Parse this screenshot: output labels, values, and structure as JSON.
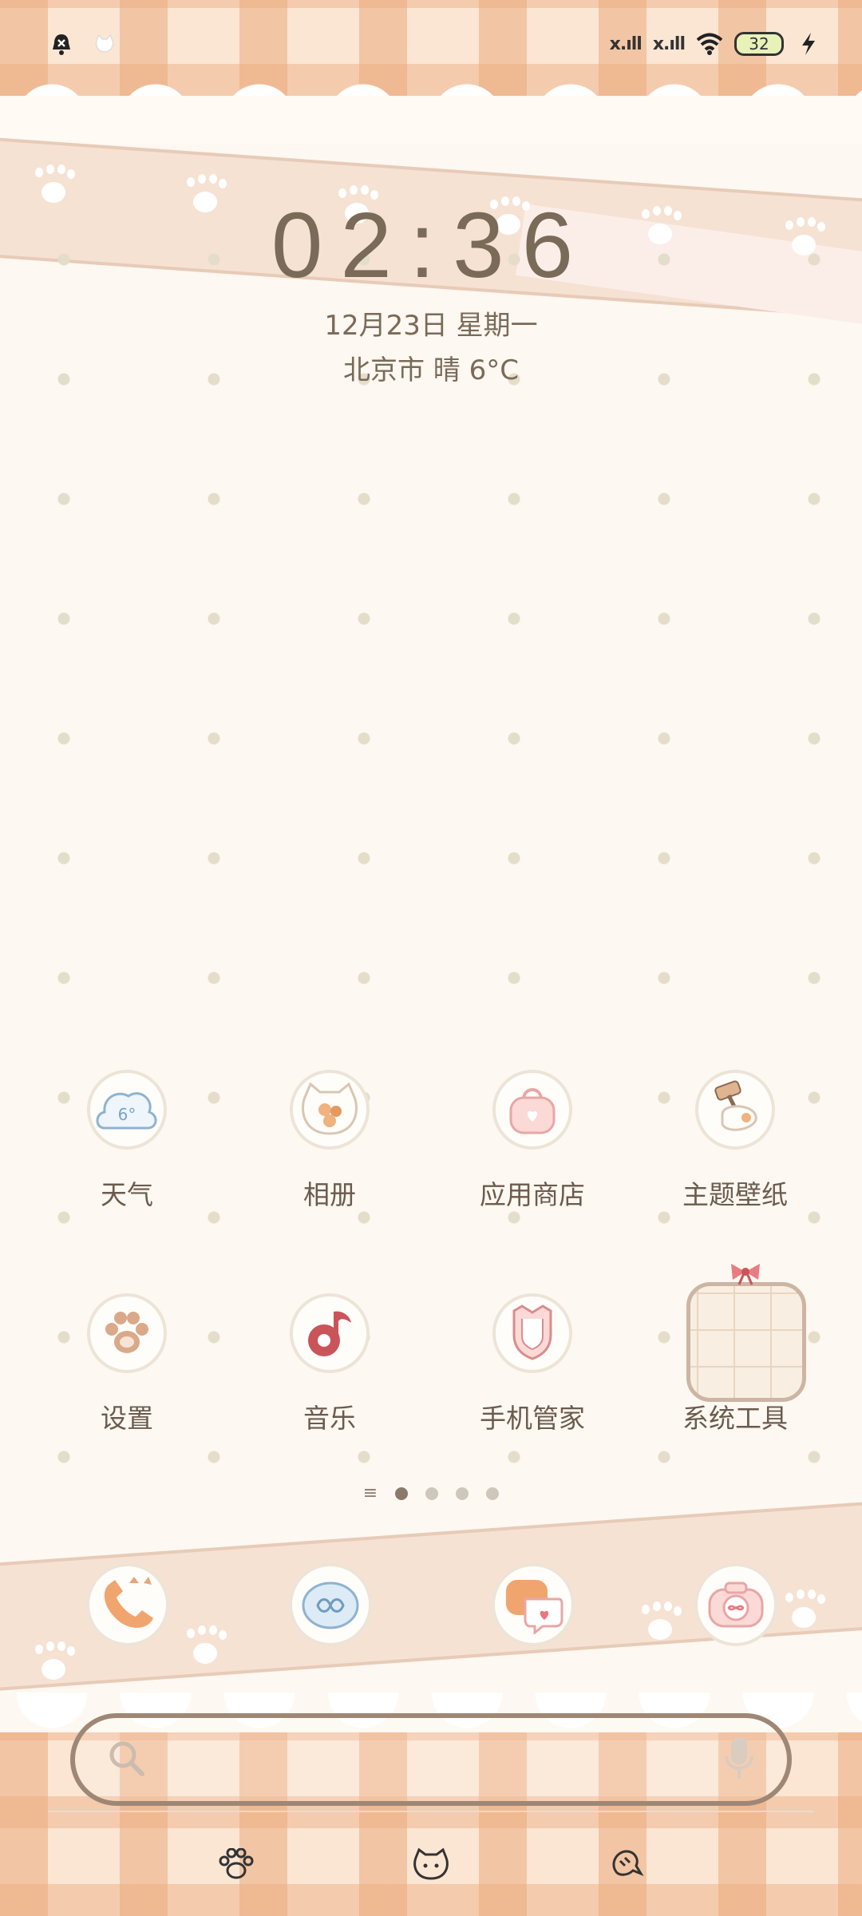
{
  "status_bar": {
    "left_icons": [
      "alarm-off-icon",
      "cat-face-icon"
    ],
    "signal1": "x.ıll",
    "signal2": "x.ıll",
    "battery": "32",
    "charging_icon": "lightning-icon"
  },
  "clock": {
    "time": "02:36",
    "date": "12月23日 星期一",
    "weather": "北京市 晴 6°C"
  },
  "apps": [
    {
      "label": "天气",
      "icon": "weather-cloud-icon",
      "badge": "6°"
    },
    {
      "label": "相册",
      "icon": "gallery-cat-icon"
    },
    {
      "label": "应用商店",
      "icon": "app-store-bag-icon"
    },
    {
      "label": "主题壁纸",
      "icon": "theme-brush-icon"
    },
    {
      "label": "设置",
      "icon": "paw-settings-icon"
    },
    {
      "label": "音乐",
      "icon": "music-note-icon"
    },
    {
      "label": "手机管家",
      "icon": "shield-security-icon"
    },
    {
      "label": "系统工具",
      "icon": "folder-icon"
    }
  ],
  "pager": {
    "menu_glyph": "≡"
  },
  "dock": [
    "phone-cat-icon",
    "browser-bubble-icon",
    "messages-icon",
    "camera-icon"
  ],
  "colors": {
    "text": "#6b5b4e",
    "accent": "#e9a47d",
    "background": "#fdf8f1"
  }
}
